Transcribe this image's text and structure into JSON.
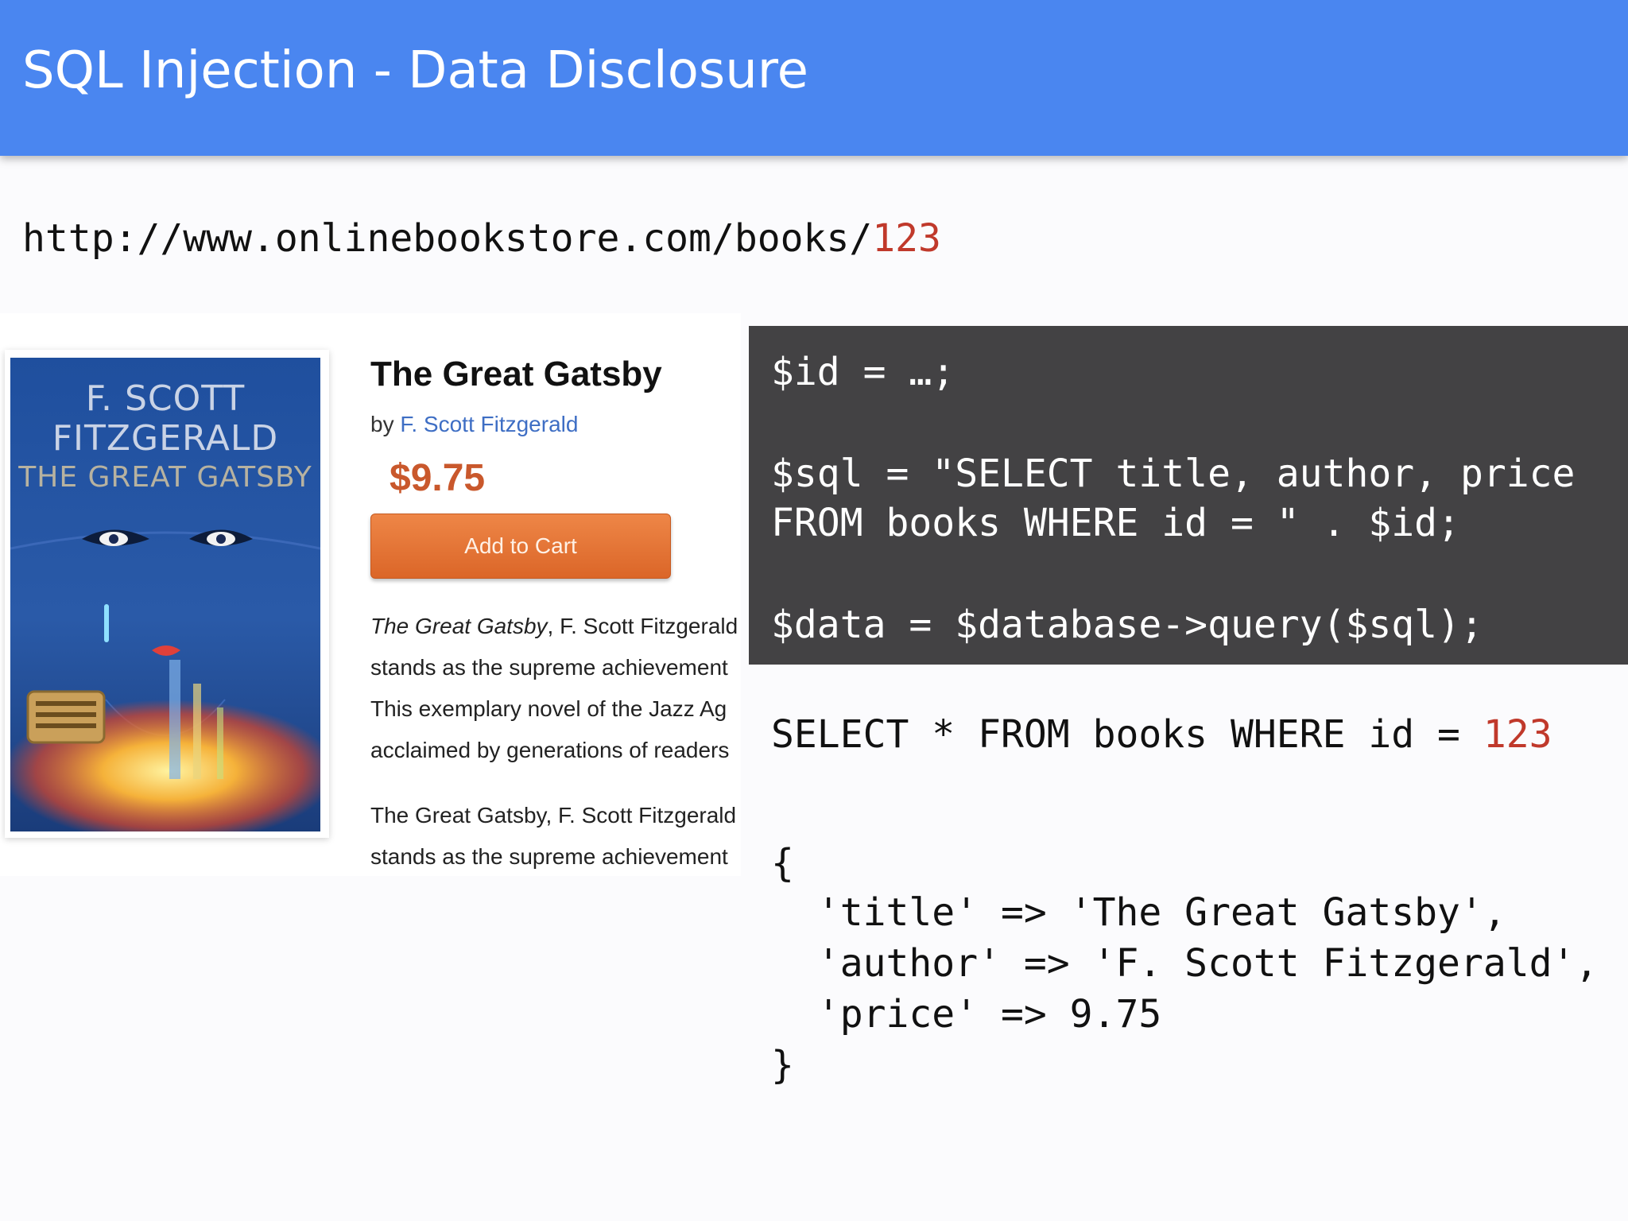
{
  "header": {
    "title": "SQL Injection - Data Disclosure"
  },
  "url": {
    "base": "http://www.onlinebookstore.com/books/",
    "id": "123"
  },
  "book": {
    "cover": {
      "line1": "F. SCOTT",
      "line2": "FITZGERALD",
      "line3": "THE GREAT GATSBY"
    },
    "title": "The Great Gatsby",
    "by_label": "by",
    "author": "F. Scott Fitzgerald",
    "price": "$9.75",
    "add_to_cart_label": "Add to Cart",
    "description": {
      "line1_title": "The Great Gatsby",
      "line1_rest": ", F. Scott Fitzgerald",
      "line2": "stands as the supreme achievement",
      "line3": "This exemplary novel of the Jazz Ag",
      "line4": "acclaimed by generations of readers",
      "line5": "The Great Gatsby, F. Scott Fitzgerald",
      "line6": "stands as the supreme achievement"
    }
  },
  "code": {
    "line1": "$id = …;",
    "line2": "$sql = \"SELECT title, author, price",
    "line3": "FROM books WHERE id = \" . $id;",
    "line4": "$data = $database->query($sql);"
  },
  "query": {
    "text": "SELECT * FROM books WHERE id = ",
    "id": "123"
  },
  "result": {
    "open": "{",
    "line1": "  'title' => 'The Great Gatsby',",
    "line2": "  'author' => 'F. Scott Fitzgerald',",
    "line3": "  'price' => 9.75",
    "close": "}"
  },
  "colors": {
    "header": "#4a86f0",
    "highlight": "#c0392b",
    "code_bg": "#434244",
    "button": "#e37232",
    "price": "#c9582c"
  }
}
